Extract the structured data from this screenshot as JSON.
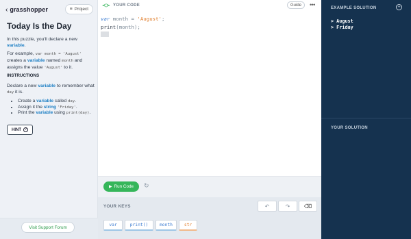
{
  "left": {
    "brand": "grasshopper",
    "project_label": "Project",
    "title": "Today Is the Day",
    "intro_pre": "In this puzzle, you'll declare a new ",
    "intro_kw": "variable",
    "intro_post": ".",
    "example_pre": "For example, ",
    "example_code1": "var month = 'August'",
    "example_mid1": " creates a ",
    "example_kw": "variable",
    "example_mid2": " named ",
    "example_code2": "month",
    "example_mid3": " and assigns the value ",
    "example_code3": "'August'",
    "example_post": " to it.",
    "instructions_heading": "INSTRUCTIONS",
    "instr_pre": "Declare a new ",
    "instr_kw": "variable",
    "instr_mid": " to remember what ",
    "instr_code": "day",
    "instr_post": " it is.",
    "bullets": [
      {
        "pre": "Create a ",
        "kw": "variable",
        "mid": " called ",
        "code": "day",
        "post": "."
      },
      {
        "pre": "Assign it the ",
        "kw": "string",
        "mid": " ",
        "code": "'Friday'",
        "post": "."
      },
      {
        "pre": "Print the ",
        "kw": "variable",
        "mid": " using ",
        "code": "print(day)",
        "post": "."
      }
    ],
    "hint_label": "HINT",
    "forum_label": "Visit Support Forum"
  },
  "center": {
    "header_label": "YOUR CODE",
    "guide_label": "Guide",
    "dots": "•••",
    "code": {
      "line1_kw": "var",
      "line1_name": " month = ",
      "line1_str": "'August'",
      "line1_end": ";",
      "line2_fn": "print",
      "line2_rest": "(month);"
    },
    "run_label": "Run Code",
    "keys_label": "YOUR KEYS",
    "keys": [
      "var",
      "print()",
      "month",
      "str"
    ]
  },
  "right": {
    "example_heading": "EXAMPLE SOLUTION",
    "output": [
      "> August",
      "> Friday"
    ],
    "your_solution_heading": "YOUR SOLUTION"
  },
  "colors": {
    "accent_green": "#35b65a",
    "keyword_blue": "#1d7fc4",
    "string_orange": "#e07e2c",
    "sidebar_dark": "#15324f"
  }
}
